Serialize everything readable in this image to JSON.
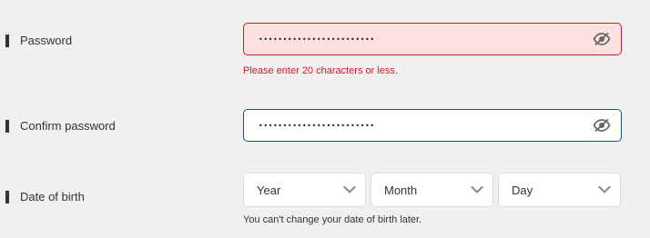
{
  "password": {
    "label": "Password",
    "value_masked": "••••••••••••••••••••••••",
    "error": "Please enter 20 characters or less.",
    "toggle_icon": "eye-slash-icon"
  },
  "confirm_password": {
    "label": "Confirm password",
    "value_masked": "••••••••••••••••••••••••",
    "toggle_icon": "eye-slash-icon"
  },
  "date_of_birth": {
    "label": "Date of birth",
    "year": "Year",
    "month": "Month",
    "day": "Day",
    "hint": "You can't change your date of birth later."
  },
  "colors": {
    "error": "#cc1a2c",
    "error_background": "#fde0e0",
    "focus_border": "#1a4d99",
    "page_background": "#f0f0f0"
  }
}
